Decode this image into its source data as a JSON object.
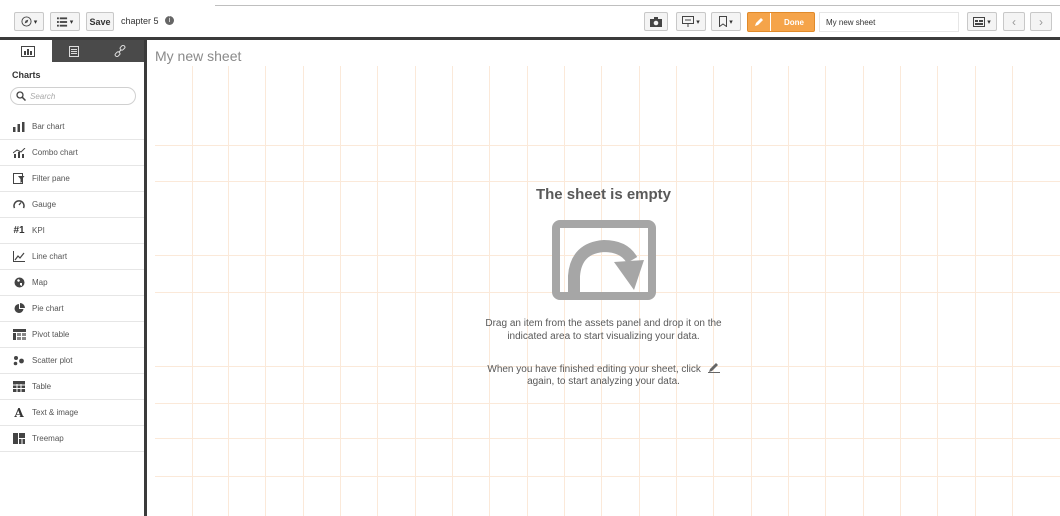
{
  "toolbar": {
    "save_label": "Save",
    "app_name": "chapter 5",
    "done_label": "Done",
    "sheet_name": "My new sheet"
  },
  "panel": {
    "title": "Charts",
    "search_placeholder": "Search",
    "items": [
      {
        "label": "Bar chart",
        "icon": "bar-chart-icon"
      },
      {
        "label": "Combo chart",
        "icon": "combo-chart-icon"
      },
      {
        "label": "Filter pane",
        "icon": "filter-pane-icon"
      },
      {
        "label": "Gauge",
        "icon": "gauge-icon"
      },
      {
        "label": "KPI",
        "icon": "kpi-icon"
      },
      {
        "label": "Line chart",
        "icon": "line-chart-icon"
      },
      {
        "label": "Map",
        "icon": "map-icon"
      },
      {
        "label": "Pie chart",
        "icon": "pie-chart-icon"
      },
      {
        "label": "Pivot table",
        "icon": "pivot-table-icon"
      },
      {
        "label": "Scatter plot",
        "icon": "scatter-plot-icon"
      },
      {
        "label": "Table",
        "icon": "table-icon"
      },
      {
        "label": "Text & image",
        "icon": "text-image-icon"
      },
      {
        "label": "Treemap",
        "icon": "treemap-icon"
      }
    ],
    "kpi_glyph": "#1",
    "text_glyph": "A"
  },
  "canvas": {
    "sheet_title": "My new sheet",
    "empty_title": "The sheet is empty",
    "hint1_line1": "Drag an item from the assets panel and drop it on the",
    "hint1_line2": "indicated area to start visualizing your data.",
    "hint2_line1": "When you have finished editing your sheet, click",
    "hint2_line2": "again, to start analyzing your data."
  },
  "colors": {
    "accent": "#f5a44a",
    "grid": "#fbe9d9",
    "dark_bar": "#3b3b3b",
    "empty_icon": "#a6a6a6"
  }
}
